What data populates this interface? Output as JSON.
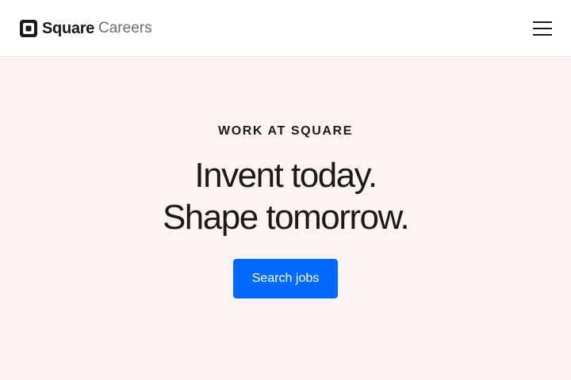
{
  "header": {
    "logo_word": "Square",
    "logo_sub": "Careers",
    "logo_icon": "square-logo-icon",
    "menu_icon": "hamburger-menu-icon"
  },
  "hero": {
    "eyebrow": "WORK AT SQUARE",
    "headline_line1": "Invent today.",
    "headline_line2": "Shape tomorrow.",
    "cta_label": "Search jobs"
  },
  "colors": {
    "hero_background": "#fdf4f2",
    "cta_background": "#006aff",
    "text": "#1a1a1a",
    "muted_text": "#6b6b6b"
  }
}
